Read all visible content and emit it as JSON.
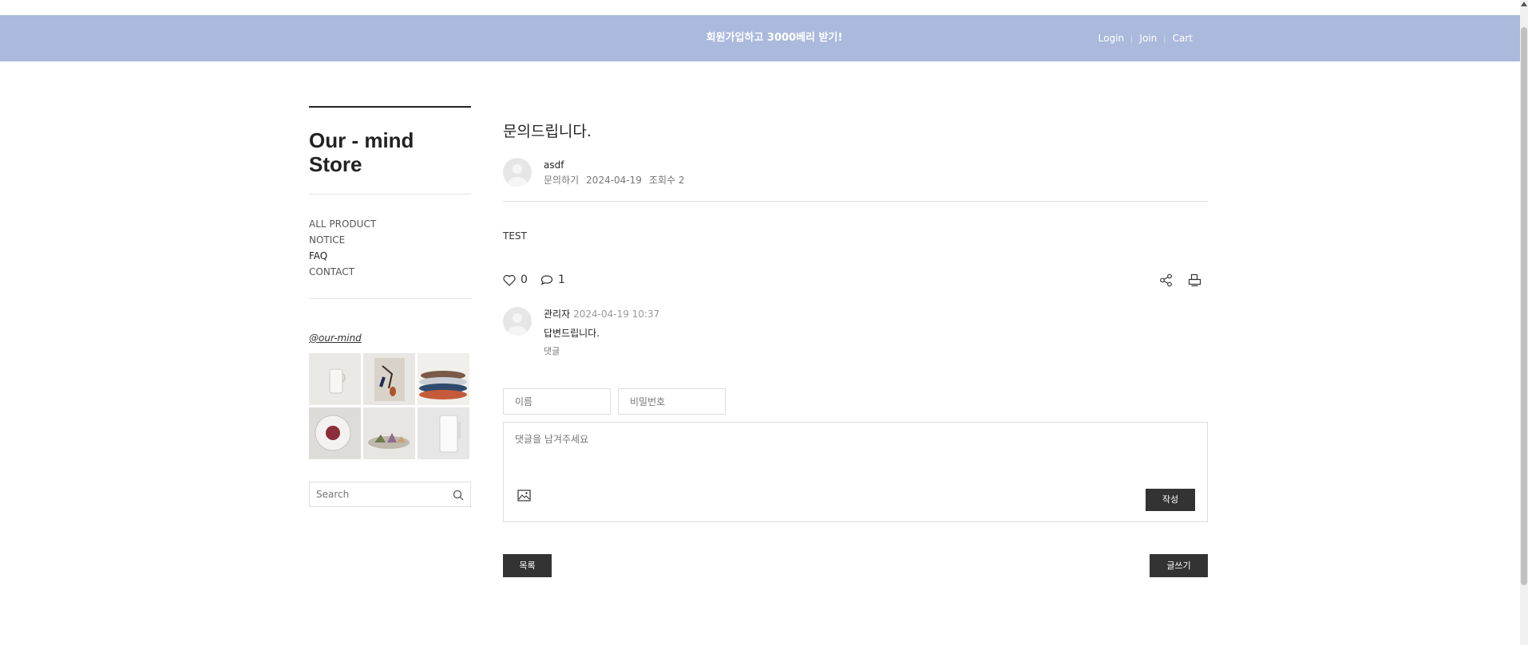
{
  "header": {
    "promo": "회원가입하고 3000베리 받기!",
    "links": [
      "Login",
      "Join",
      "Cart"
    ]
  },
  "sidebar": {
    "brand_line1": "Our - mind",
    "brand_line2": "Store",
    "menu": [
      "ALL PRODUCT",
      "NOTICE",
      "FAQ",
      "CONTACT"
    ],
    "active_menu": "FAQ",
    "instagram": "@our-mind",
    "search_placeholder": "Search"
  },
  "post": {
    "title": "문의드립니다.",
    "author": "asdf",
    "category": "문의하기",
    "date": "2024-04-19",
    "views": "조회수 2",
    "body": "TEST",
    "likes": "0",
    "comments": "1"
  },
  "comment": {
    "author": "관리자",
    "datetime": "2024-04-19 10:37",
    "text": "답변드립니다.",
    "reply_label": "댓글"
  },
  "form": {
    "name_placeholder": "이름",
    "password_placeholder": "비밀번호",
    "comment_placeholder": "댓글을 남겨주세요",
    "submit_label": "작성"
  },
  "buttons": {
    "list_label": "목록",
    "write_label": "글쓰기"
  },
  "colors": {
    "topbar": "#aab9dc",
    "button_dark": "#333333"
  }
}
